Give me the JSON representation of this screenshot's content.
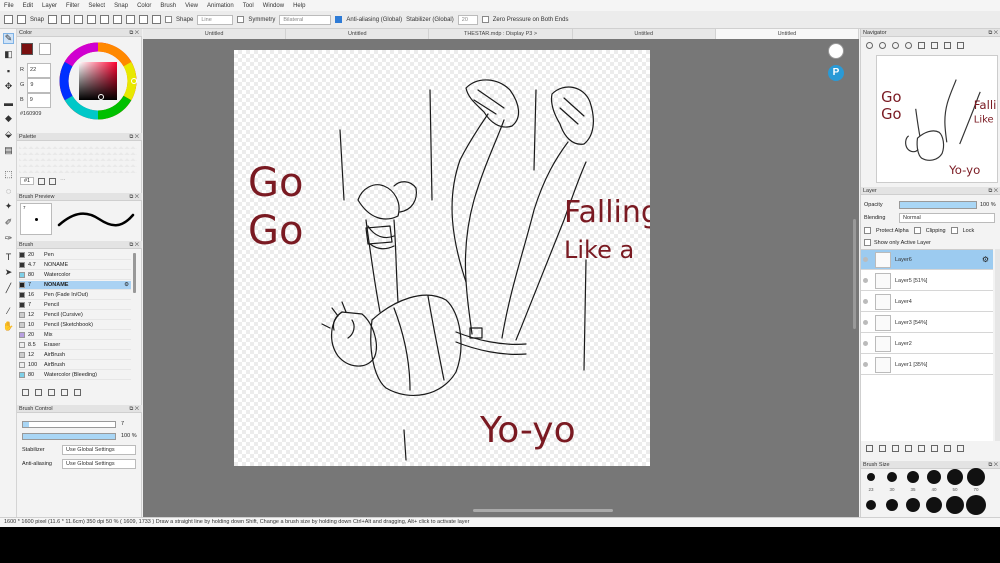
{
  "menu": [
    "File",
    "Edit",
    "Layer",
    "Filter",
    "Select",
    "Snap",
    "Color",
    "Brush",
    "View",
    "Animation",
    "Tool",
    "Window",
    "Help"
  ],
  "toolbar": {
    "snap": "Snap",
    "shape": "Shape",
    "shape_value": "Line",
    "symmetry": "Symmetry",
    "symmetry_value": "Bilateral",
    "antialiasing": "Anti-aliasing (Global)",
    "stabilizer": "Stabilizer (Global)",
    "stabilizer_value": "20",
    "zero_pressure": "Zero Pressure on Both Ends"
  },
  "tabs": [
    "Untitled",
    "Untitled",
    "THESTAR.mdp : Display P3 >",
    "Untitled",
    "Untitled"
  ],
  "color_panel": {
    "title": "Color",
    "r_label": "R",
    "r": "22",
    "g_label": "G",
    "g": "9",
    "b_label": "B",
    "b": "9",
    "hex": "#160909",
    "main_color": "#7a1010",
    "sub_color": "#ffffff"
  },
  "palette_panel": {
    "title": "Palette",
    "index": "#1"
  },
  "brush_preview_panel": {
    "title": "Brush Preview",
    "size": "7"
  },
  "brush_panel": {
    "title": "Brush",
    "brushes": [
      {
        "size": "20",
        "name": "Pen",
        "color": "#333333"
      },
      {
        "size": "4.7",
        "name": "NONAME",
        "color": "#333333"
      },
      {
        "size": "80",
        "name": "Watercolor",
        "color": "#7fd0e8"
      },
      {
        "size": "7",
        "name": "NONAME",
        "color": "#222222",
        "selected": true
      },
      {
        "size": "16",
        "name": "Pen (Fade In/Out)",
        "color": "#333333"
      },
      {
        "size": "7",
        "name": "Pencil",
        "color": "#333333"
      },
      {
        "size": "12",
        "name": "Pencil (Cursive)",
        "color": "#cccccc"
      },
      {
        "size": "10",
        "name": "Pencil (Sketchbook)",
        "color": "#cccccc"
      },
      {
        "size": "20",
        "name": "Mix",
        "color": "#b8a0e0"
      },
      {
        "size": "8.5",
        "name": "Eraser",
        "color": "#eeeeee"
      },
      {
        "size": "12",
        "name": "AirBrush",
        "color": "#cccccc"
      },
      {
        "size": "100",
        "name": "AirBrush",
        "color": "#eeeeee"
      },
      {
        "size": "80",
        "name": "Watercolor (Bleeding)",
        "color": "#7fd0e8"
      }
    ]
  },
  "brush_control": {
    "title": "Brush Control",
    "size": "7",
    "opacity": "100 %",
    "opacity_fraction": 1.0,
    "size_fraction": 0.07,
    "stabilizer_label": "Stabilizer",
    "stabilizer_value": "Use Global Settings",
    "antialias_label": "Anti-aliasing",
    "antialias_value": "Use Global Settings"
  },
  "navigator": {
    "title": "Navigator"
  },
  "layer_panel": {
    "title": "Layer",
    "opacity_label": "Opacity",
    "opacity_value": "100 %",
    "opacity_fraction": 1.0,
    "blending_label": "Blending",
    "blending_value": "Normal",
    "protect_alpha": "Protect Alpha",
    "clipping": "Clipping",
    "lock": "Lock",
    "show_only_active": "Show only Active Layer",
    "layers": [
      {
        "name": "Layer6",
        "selected": true
      },
      {
        "name": "Layer5 [51%]"
      },
      {
        "name": "Layer4"
      },
      {
        "name": "Layer3 [54%]"
      },
      {
        "name": "Layer2"
      },
      {
        "name": "Layer1 [35%]"
      }
    ]
  },
  "brush_size_panel": {
    "title": "Brush Size",
    "sizes": [
      "23",
      "30",
      "35",
      "40",
      "50",
      "70"
    ]
  },
  "canvas_text": {
    "go1": "Go",
    "go2": "Go",
    "falling": "Falling",
    "like_a": "Like a",
    "yoyo": "Yo-yo",
    "color": "#7a1a22"
  },
  "status": "1600 * 1600 pixel   (11.6 * 11.6cm)   350 dpi   50 %   ( 1609, 1733 )   Draw a straight line by holding down Shift, Change a brush size by holding down Ctrl+Alt and dragging, Alt+ click to activate layer"
}
